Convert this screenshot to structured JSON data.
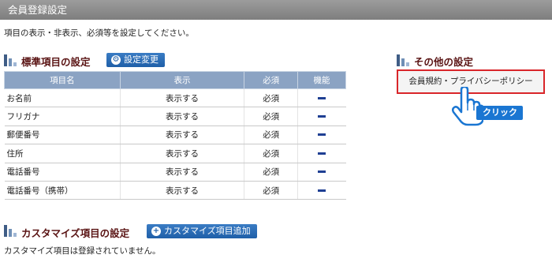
{
  "page": {
    "title": "会員登録設定",
    "description": "項目の表示・非表示、必須等を設定してください。"
  },
  "standard_section": {
    "title": "標準項目の設定",
    "button_label": "設定変更",
    "columns": [
      "項目名",
      "表示",
      "必須",
      "機能"
    ],
    "rows": [
      {
        "name": "お名前",
        "display": "表示する",
        "required": "必須"
      },
      {
        "name": "フリガナ",
        "display": "表示する",
        "required": "必須"
      },
      {
        "name": "郵便番号",
        "display": "表示する",
        "required": "必須"
      },
      {
        "name": "住所",
        "display": "表示する",
        "required": "必須"
      },
      {
        "name": "電話番号",
        "display": "表示する",
        "required": "必須"
      },
      {
        "name": "電話番号（携帯）",
        "display": "表示する",
        "required": "必須"
      }
    ]
  },
  "other_section": {
    "title": "その他の設定",
    "link_label": "会員規約・プライバシーポリシー",
    "click_badge": "クリック"
  },
  "custom_section": {
    "title": "カスタマイズ項目の設定",
    "button_label": "カスタマイズ項目追加",
    "empty_message": "カスタマイズ項目は登録されていません。"
  },
  "colors": {
    "header_bar": "#8a8a8a",
    "section_title": "#5a1414",
    "button": "#1f5fa8",
    "table_header": "#8ba3c3",
    "highlight_border": "#d9262a"
  }
}
